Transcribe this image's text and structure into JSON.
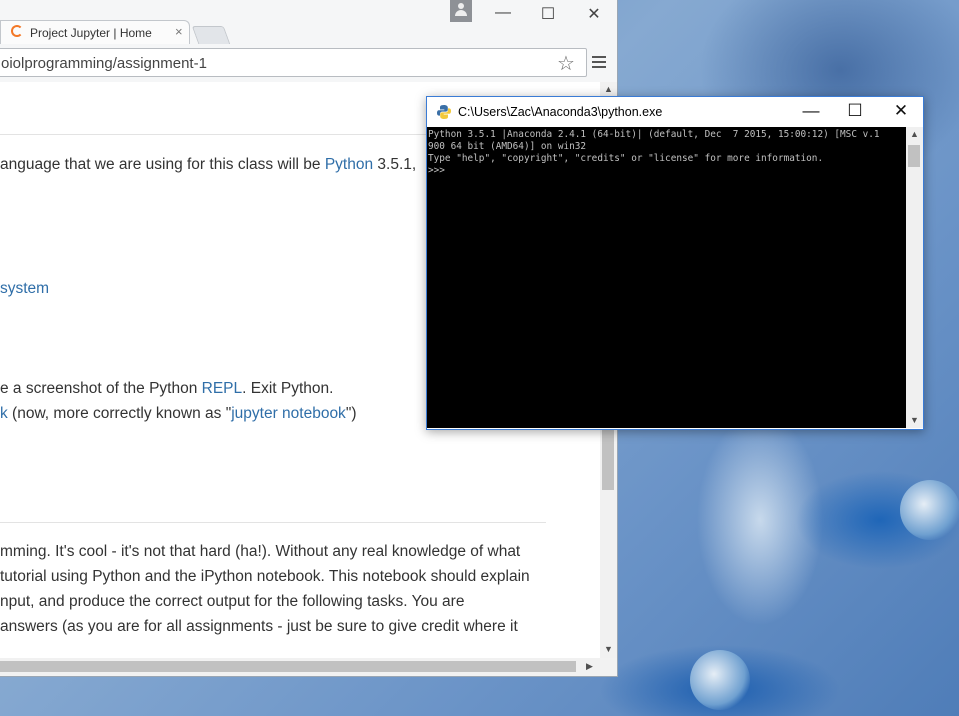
{
  "browser": {
    "tab_title": "Project Jupyter | Home",
    "tab_close": "×",
    "url": "oiolprogramming/assignment-1",
    "star": "☆",
    "window_controls": {
      "minimize": "—",
      "maximize": "☐",
      "close": "✕"
    }
  },
  "notebook": {
    "line1_prefix": "anguage that we are using for this class will be ",
    "line1_link": "Python",
    "line1_suffix": " 3.5.1,",
    "line2_link": "system",
    "line3_prefix": "e a screenshot of the Python ",
    "line3_link": "REPL",
    "line3_suffix": ". Exit Python.",
    "line4_link1": "k",
    "line4_prefix": " (now, more correctly known as \"",
    "line4_link2": "jupyter notebook",
    "line4_suffix": "\")",
    "para": [
      "mming. It's cool - it's not that hard (ha!). Without any real knowledge of what",
      "tutorial using Python and the iPython notebook. This notebook should explain",
      "nput, and produce the correct output for the following tasks. You are",
      "answers (as you are for all assignments - just be sure to give credit where it"
    ]
  },
  "console": {
    "title": "C:\\Users\\Zac\\Anaconda3\\python.exe",
    "controls": {
      "minimize": "—",
      "maximize": "☐",
      "close": "✕"
    },
    "lines": [
      "Python 3.5.1 |Anaconda 2.4.1 (64-bit)| (default, Dec  7 2015, 15:00:12) [MSC v.1",
      "900 64 bit (AMD64)] on win32",
      "Type \"help\", \"copyright\", \"credits\" or \"license\" for more information.",
      ">>>"
    ]
  },
  "colors": {
    "link": "#2f6ea8",
    "console_bg": "#000000",
    "console_text": "#c0c0c0",
    "jupyter_orange": "#f37726"
  }
}
